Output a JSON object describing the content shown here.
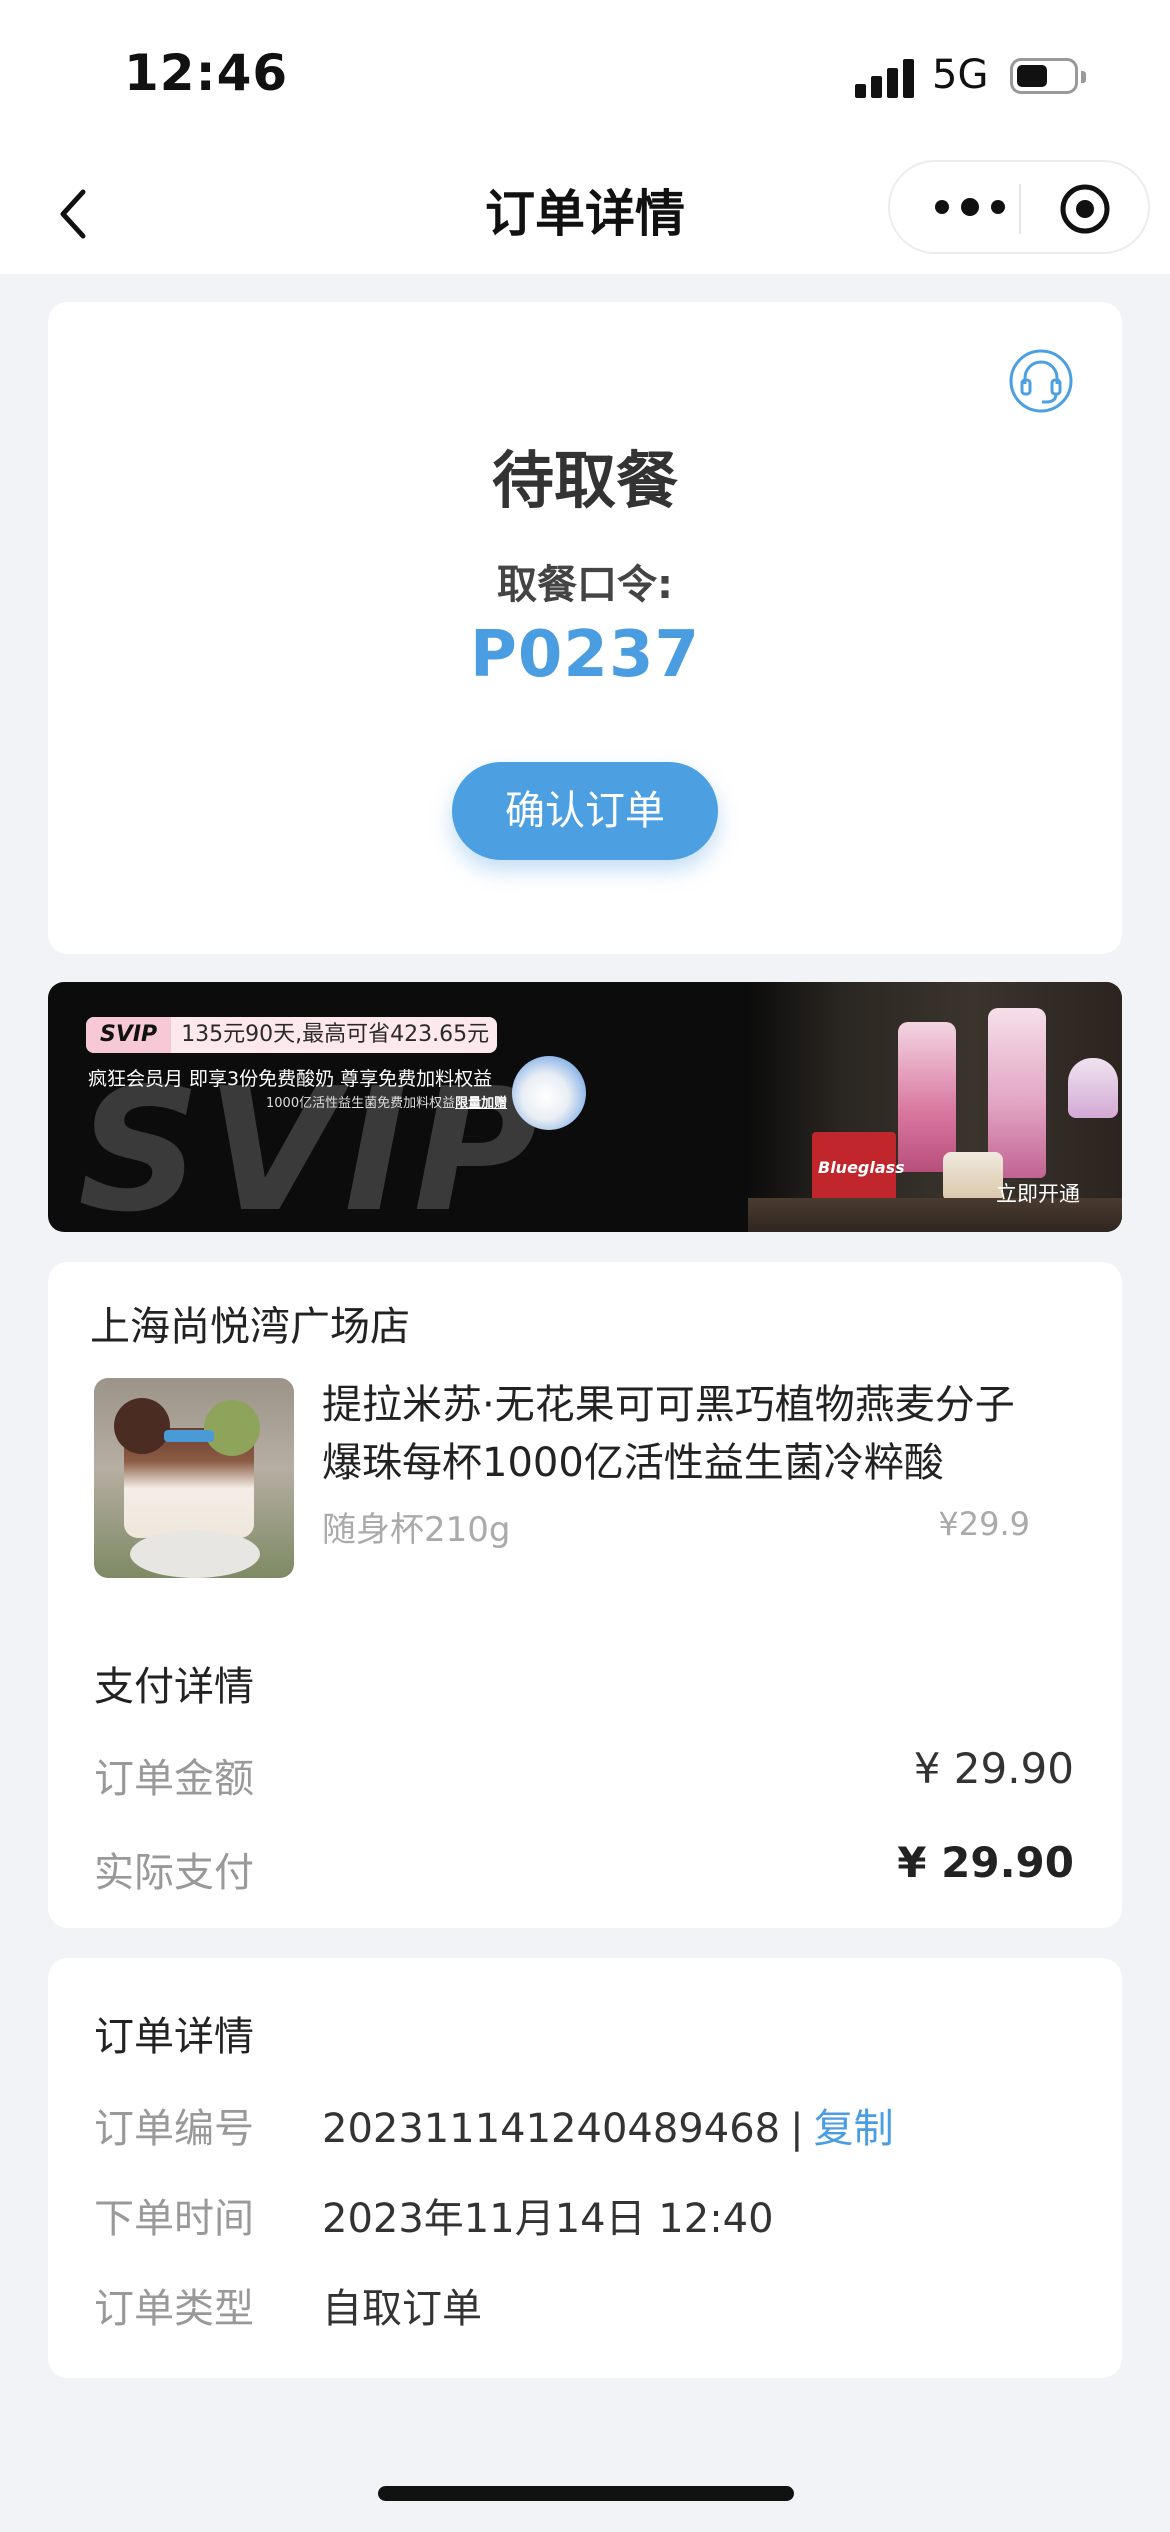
{
  "status_bar": {
    "time": "12:46",
    "network": "5G"
  },
  "nav": {
    "title": "订单详情"
  },
  "order_status": {
    "title": "待取餐",
    "pickup_label": "取餐口令:",
    "pickup_code": "P0237",
    "confirm_button": "确认订单"
  },
  "banner": {
    "tag_chip": "SVIP",
    "tag_text": "135元90天,最高可省423.65元",
    "line1": "疯狂会员月  即享3份免费酸奶  尊享免费加料权益",
    "line2": "1000亿活性益生菌免费加料权益",
    "line2_emph": "限量加赠",
    "big_text": "SVIP",
    "cta": "立即开通",
    "brand_box": "Blueglass"
  },
  "store": {
    "name": "上海尚悦湾广场店",
    "product": {
      "name": "提拉米苏·无花果可可黑巧植物燕麦分子爆珠每杯1000亿活性益生菌冷粹酸",
      "spec": "随身杯210g",
      "price": "¥29.9"
    }
  },
  "payment": {
    "title": "支付详情",
    "order_amount_label": "订单金额",
    "order_amount": "¥ 29.90",
    "actual_label": "实际支付",
    "actual_amount": "¥ 29.90"
  },
  "details": {
    "title": "订单详情",
    "order_no_label": "订单编号",
    "order_no": "202311141240489468",
    "separator": "|",
    "copy": "复制",
    "time_label": "下单时间",
    "time": "2023年11月14日 12:40",
    "type_label": "订单类型",
    "type": "自取订单"
  },
  "colors": {
    "accent": "#4c9fe1",
    "background": "#f2f3f7"
  },
  "icons": [
    "back-icon",
    "more-icon",
    "target-icon",
    "headset-icon",
    "signal-icon",
    "battery-icon"
  ]
}
